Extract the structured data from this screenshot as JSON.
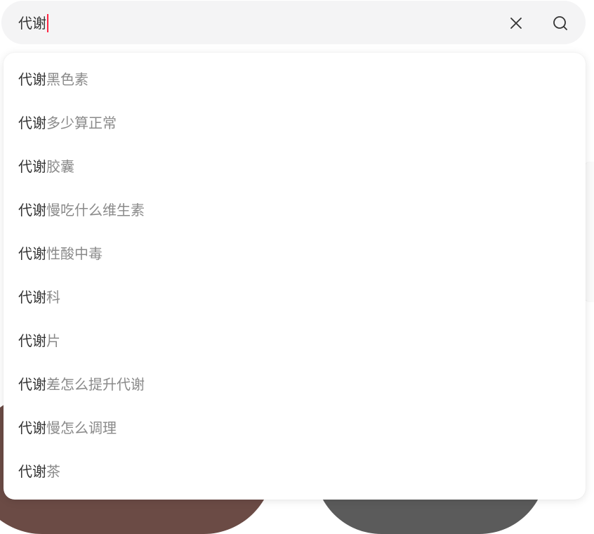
{
  "search": {
    "value": "代谢",
    "clear_icon": "close-icon",
    "search_icon": "search-icon"
  },
  "suggestions": [
    {
      "match": "代谢",
      "rest": "黑色素"
    },
    {
      "match": "代谢",
      "rest": "多少算正常"
    },
    {
      "match": "代谢",
      "rest": "胶囊"
    },
    {
      "match": "代谢",
      "rest": "慢吃什么维生素"
    },
    {
      "match": "代谢",
      "rest": "性酸中毒"
    },
    {
      "match": "代谢",
      "rest": "科"
    },
    {
      "match": "代谢",
      "rest": "片"
    },
    {
      "match": "代谢",
      "rest": "差怎么提升代谢"
    },
    {
      "match": "代谢",
      "rest": "慢怎么调理"
    },
    {
      "match": "代谢",
      "rest": "茶"
    }
  ],
  "colors": {
    "caret": "#ff2442",
    "search_bar_bg": "#f4f4f5",
    "match_text": "#333333",
    "rest_text": "#8a8a8a"
  }
}
